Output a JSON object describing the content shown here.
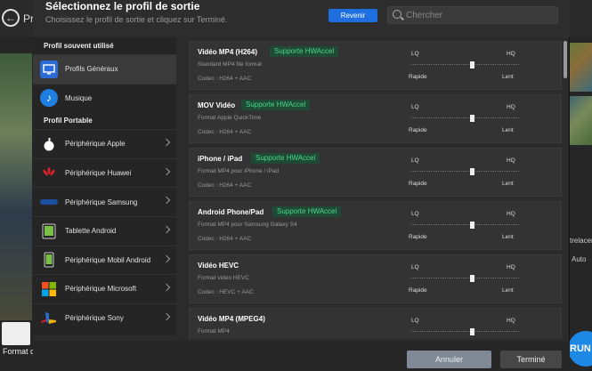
{
  "background": {
    "prefix": "Pr",
    "format_label": "Format c",
    "right_text": "trelacer",
    "auto_text": "Auto",
    "run_text": "RUN"
  },
  "dialog": {
    "title": "Sélectionnez le profil de sortie",
    "subtitle": "Choisissez le profil de sortie et cliquez sur Terminé.",
    "revenir": "Revenir",
    "search_placeholder": "Chercher"
  },
  "sidebar": {
    "section1": "Profil souvent utilisé",
    "section2": "Profil Portable",
    "items": [
      {
        "label": "Profils Généraux",
        "icon": "monitor-icon"
      },
      {
        "label": "Musique",
        "icon": "music-icon"
      },
      {
        "label": "Périphérique Apple",
        "icon": "apple-icon"
      },
      {
        "label": "Périphérique Huawei",
        "icon": "huawei-icon"
      },
      {
        "label": "Périphérique Samsung",
        "icon": "samsung-icon"
      },
      {
        "label": "Tablette Android",
        "icon": "tablet-icon"
      },
      {
        "label": "Périphérique Mobil Android",
        "icon": "phone-icon"
      },
      {
        "label": "Périphérique Microsoft",
        "icon": "microsoft-icon"
      },
      {
        "label": "Périphérique Sony",
        "icon": "playstation-icon"
      }
    ]
  },
  "labels": {
    "lq": "LQ",
    "hq": "HQ",
    "rapide": "Rapide",
    "lent": "Lent"
  },
  "profiles": [
    {
      "name": "Vidéo MP4 (H264)",
      "badge": "Supporte HWAccel",
      "desc": "Standard MP4 file format",
      "codec": "Codec : H264 + AAC",
      "quality": 0.57
    },
    {
      "name": "MOV Vidéo",
      "badge": "Supporte HWAccel",
      "desc": "Format Apple QuickTime",
      "codec": "Codec : H264 + AAC",
      "quality": 0.57
    },
    {
      "name": "iPhone / iPad",
      "badge": "Supporte HWAccel",
      "desc": "Format MP4 pour iPhone / iPad",
      "codec": "Codec : H264 + AAC",
      "quality": 0.57
    },
    {
      "name": "Android Phone/Pad",
      "badge": "Supporte HWAccel",
      "desc": "Format MP4 pour Samsung Galaxy S4",
      "codec": "Codec : H264 + AAC",
      "quality": 0.57
    },
    {
      "name": "Vidéo HEVC",
      "badge": "",
      "desc": "Format vidéo HEVC",
      "codec": "Codec : HEVC + AAC",
      "quality": 0.57
    },
    {
      "name": "Vidéo MP4 (MPEG4)",
      "badge": "",
      "desc": "Format MP4",
      "codec": "",
      "quality": 0.57
    }
  ],
  "footer": {
    "annuler": "Annuler",
    "termine": "Terminé"
  }
}
